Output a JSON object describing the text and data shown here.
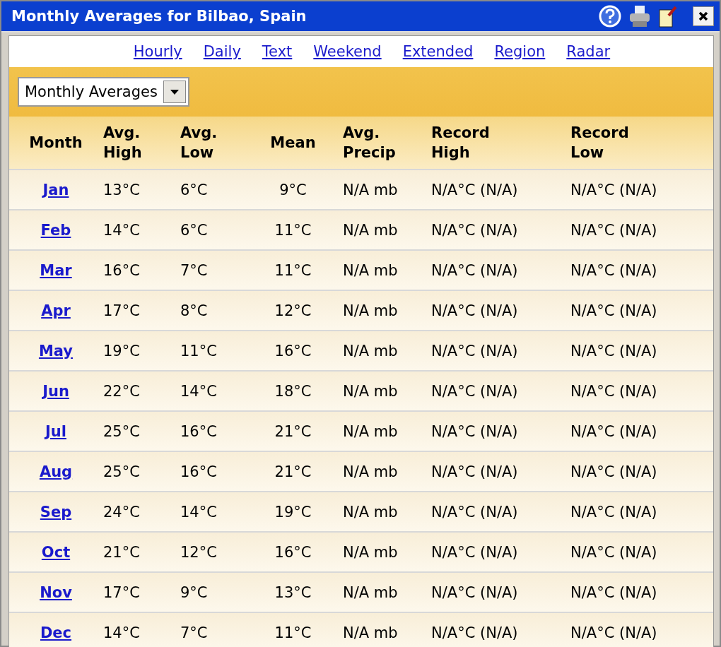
{
  "window": {
    "title": "Monthly Averages for Bilbao, Spain"
  },
  "nav_links": [
    "Hourly",
    "Daily",
    "Text",
    "Weekend",
    "Extended",
    "Region",
    "Radar"
  ],
  "view_select": {
    "value": "Monthly Averages"
  },
  "table": {
    "columns": [
      "Month",
      "Avg.\nHigh",
      "Avg.\nLow",
      "Mean",
      "Avg.\nPrecip",
      "Record\nHigh",
      "Record\nLow"
    ],
    "rows": [
      [
        "Jan",
        "13°C",
        "6°C",
        "9°C",
        "N/A mb",
        "N/A°C (N/A)",
        "N/A°C (N/A)"
      ],
      [
        "Feb",
        "14°C",
        "6°C",
        "11°C",
        "N/A mb",
        "N/A°C (N/A)",
        "N/A°C (N/A)"
      ],
      [
        "Mar",
        "16°C",
        "7°C",
        "11°C",
        "N/A mb",
        "N/A°C (N/A)",
        "N/A°C (N/A)"
      ],
      [
        "Apr",
        "17°C",
        "8°C",
        "12°C",
        "N/A mb",
        "N/A°C (N/A)",
        "N/A°C (N/A)"
      ],
      [
        "May",
        "19°C",
        "11°C",
        "16°C",
        "N/A mb",
        "N/A°C (N/A)",
        "N/A°C (N/A)"
      ],
      [
        "Jun",
        "22°C",
        "14°C",
        "18°C",
        "N/A mb",
        "N/A°C (N/A)",
        "N/A°C (N/A)"
      ],
      [
        "Jul",
        "25°C",
        "16°C",
        "21°C",
        "N/A mb",
        "N/A°C (N/A)",
        "N/A°C (N/A)"
      ],
      [
        "Aug",
        "25°C",
        "16°C",
        "21°C",
        "N/A mb",
        "N/A°C (N/A)",
        "N/A°C (N/A)"
      ],
      [
        "Sep",
        "24°C",
        "14°C",
        "19°C",
        "N/A mb",
        "N/A°C (N/A)",
        "N/A°C (N/A)"
      ],
      [
        "Oct",
        "21°C",
        "12°C",
        "16°C",
        "N/A mb",
        "N/A°C (N/A)",
        "N/A°C (N/A)"
      ],
      [
        "Nov",
        "17°C",
        "9°C",
        "13°C",
        "N/A mb",
        "N/A°C (N/A)",
        "N/A°C (N/A)"
      ],
      [
        "Dec",
        "14°C",
        "7°C",
        "11°C",
        "N/A mb",
        "N/A°C (N/A)",
        "N/A°C (N/A)"
      ]
    ]
  }
}
